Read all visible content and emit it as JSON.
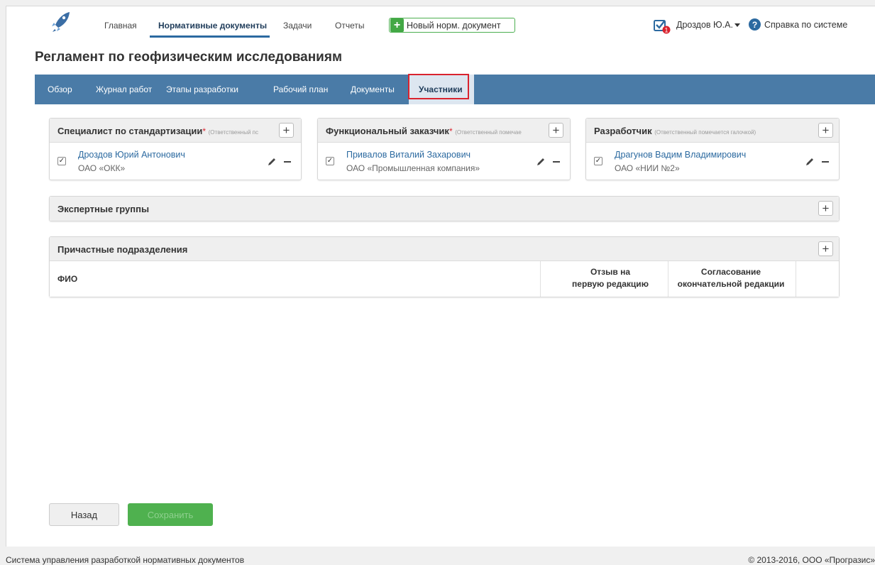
{
  "nav": {
    "items": [
      "Главная",
      "Нормативные документы",
      "Задачи",
      "Отчеты"
    ],
    "new_doc_label": "Новый норм. документ",
    "tasks_badge": "1",
    "user_name": "Дроздов Ю.А.",
    "help_label": "Справка по системе"
  },
  "page": {
    "title": "Регламент по геофизическим исследованиям"
  },
  "tabs": [
    "Обзор",
    "Журнал работ",
    "Этапы разработки",
    "Рабочий план",
    "Документы",
    "Участники"
  ],
  "active_tab": "Участники",
  "panels": {
    "specialist": {
      "title": "Специалист по стандартизации",
      "required_mark": "*",
      "hint": "(Ответственный пс",
      "person": {
        "name": "Дроздов Юрий Антонович",
        "org": "ОАО «ОКК»",
        "checked": true
      }
    },
    "customer": {
      "title": "Функциональный заказчик",
      "required_mark": "*",
      "hint": "(Ответственный помечае",
      "person": {
        "name": "Привалов Виталий Захарович",
        "org": "ОАО «Промышленная компания»",
        "checked": true
      }
    },
    "developer": {
      "title": "Разработчик",
      "hint": "(Ответственный помечается галочкой)",
      "person": {
        "name": "Драгунов Вадим Владимирович",
        "org": "ОАО «НИИ №2»",
        "checked": true
      }
    },
    "experts": {
      "title": "Экспертные группы"
    },
    "departments": {
      "title": "Причастные подразделения",
      "columns": {
        "fio": "ФИО",
        "review_line1": "Отзыв на",
        "review_line2": "первую редакцию",
        "approval_line1": "Согласование",
        "approval_line2": "окончательной редакции"
      }
    }
  },
  "buttons": {
    "back": "Назад",
    "save": "Сохранить"
  },
  "footer": {
    "left": "Система управления разработкой нормативных документов",
    "right": "© 2013-2016, ООО «Програзис»"
  },
  "colors": {
    "accent": "#4a7ba7",
    "link": "#2c6aa0",
    "success": "#4fb14f",
    "danger": "#d9232e"
  }
}
